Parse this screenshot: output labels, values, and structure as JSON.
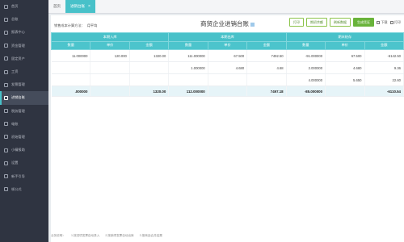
{
  "sidebar": {
    "items": [
      {
        "label": "首页",
        "icon": "home-icon",
        "active": false
      },
      {
        "label": "总账",
        "icon": "book-icon",
        "active": false
      },
      {
        "label": "报表中心",
        "icon": "report-icon",
        "active": false
      },
      {
        "label": "资金管理",
        "icon": "wallet-icon",
        "active": false
      },
      {
        "label": "固定资产",
        "icon": "asset-icon",
        "active": false
      },
      {
        "label": "工资",
        "icon": "salary-icon",
        "active": false
      },
      {
        "label": "发票管理",
        "icon": "invoice-icon",
        "active": false
      },
      {
        "label": "进销台账",
        "icon": "ledger-icon",
        "active": true
      },
      {
        "label": "税务管理",
        "icon": "tax-icon",
        "active": false
      },
      {
        "label": "电账",
        "icon": "file-icon",
        "active": false
      },
      {
        "label": "初始管理",
        "icon": "setup-icon",
        "active": false
      },
      {
        "label": "小精报助",
        "icon": "help-icon",
        "active": false
      },
      {
        "label": "设置",
        "icon": "gear-icon",
        "active": false
      },
      {
        "label": "新手引导",
        "icon": "guide-icon",
        "active": false
      },
      {
        "label": "帧公式",
        "icon": "formula-icon",
        "active": false
      }
    ]
  },
  "tabs": [
    {
      "label": "首页",
      "active": false
    },
    {
      "label": "进销台账",
      "active": true,
      "close": "×"
    }
  ],
  "sheet": {
    "title": "商贸企业进销台账",
    "method_label": "销售成本计算方法：",
    "method_value": "月平均"
  },
  "buttons": {
    "b1": "打印",
    "b2": "期初余额",
    "b3": "刷新数据",
    "b4": "生成凭证",
    "download": "下载",
    "print": "打印"
  },
  "table": {
    "groups": [
      "本期入库",
      "本期出库",
      "期末结存"
    ],
    "subheads": [
      "数量",
      "单价",
      "金额",
      "数量",
      "单价",
      "金额",
      "数量",
      "单价",
      "金额"
    ],
    "rows": [
      [
        "11.000000",
        "120.000",
        "1320.00",
        "111.000000",
        "67.500",
        "7492.50",
        "-91.000000",
        "67.500",
        "-6142.50"
      ],
      [
        "",
        "",
        "",
        "1.000000",
        "4.680",
        "4.68",
        "2.000000",
        "4.680",
        "9.36"
      ],
      [
        "",
        "",
        "",
        "",
        "",
        "",
        "4.000000",
        "5.650",
        "22.60"
      ]
    ],
    "total": [
      ".000000",
      "",
      "1320.00",
      "112.000000",
      "",
      "7497.18",
      "-85.000000",
      "",
      "-6110.54"
    ]
  },
  "footer": {
    "notes": [
      "业务说明：",
      "1.按进项发票自动录入",
      "2.按销项发票自动出库",
      "3.按商品合并结果"
    ]
  }
}
